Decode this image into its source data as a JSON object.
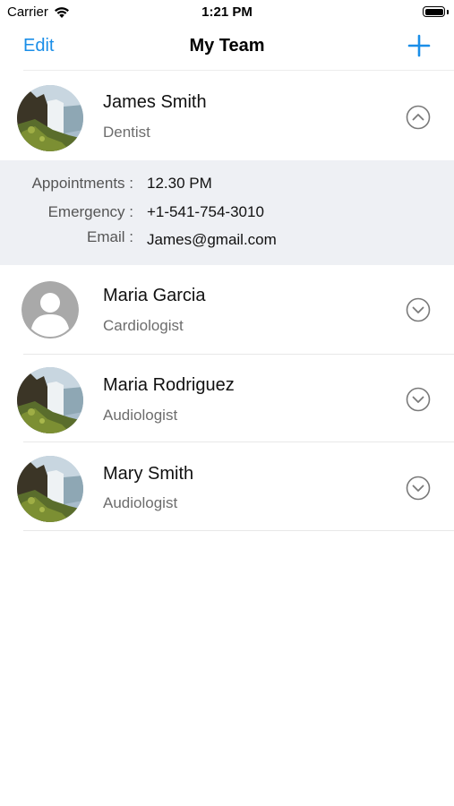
{
  "status_bar": {
    "carrier": "Carrier",
    "time": "1:21 PM"
  },
  "nav": {
    "edit_label": "Edit",
    "title": "My Team",
    "add_icon": "plus-icon"
  },
  "colors": {
    "accent": "#1a8ee8",
    "details_bg": "#eef0f4",
    "secondary_text": "#6d6d6d"
  },
  "team": [
    {
      "name": "James Smith",
      "role": "Dentist",
      "avatar": "waterfall-photo",
      "expanded": true,
      "chevron_icon": "chevron-up-circle-icon"
    },
    {
      "name": "Maria Garcia",
      "role": "Cardiologist",
      "avatar": "default-person",
      "expanded": false,
      "chevron_icon": "chevron-down-circle-icon"
    },
    {
      "name": "Maria Rodriguez",
      "role": "Audiologist",
      "avatar": "waterfall-photo",
      "expanded": false,
      "chevron_icon": "chevron-down-circle-icon"
    },
    {
      "name": "Mary Smith",
      "role": "Audiologist",
      "avatar": "waterfall-photo",
      "expanded": false,
      "chevron_icon": "chevron-down-circle-icon"
    }
  ],
  "details": {
    "appointments_label": "Appointments :",
    "appointments_value": "12.30 PM",
    "emergency_label": "Emergency :",
    "emergency_value": "+1-541-754-3010",
    "email_label": "Email :",
    "email_value": "James@gmail.com"
  }
}
